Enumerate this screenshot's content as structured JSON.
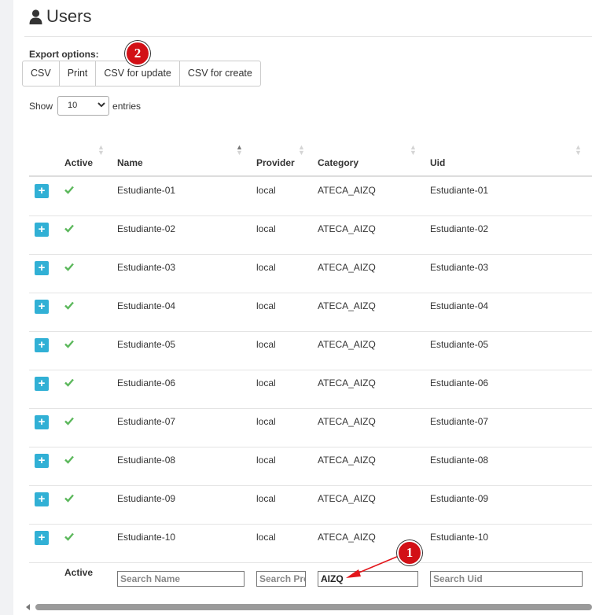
{
  "page": {
    "title": "Users",
    "icon": "user-icon"
  },
  "export": {
    "label": "Export options:",
    "buttons": [
      "CSV",
      "Print",
      "CSV for update",
      "CSV for create"
    ]
  },
  "length": {
    "show": "Show",
    "value": "10",
    "entries": "entries"
  },
  "table": {
    "columns": [
      "Active",
      "Name",
      "Provider",
      "Category",
      "Uid"
    ],
    "rows": [
      {
        "name": "Estudiante-01",
        "provider": "local",
        "category": "ATECA_AIZQ",
        "uid": "Estudiante-01"
      },
      {
        "name": "Estudiante-02",
        "provider": "local",
        "category": "ATECA_AIZQ",
        "uid": "Estudiante-02"
      },
      {
        "name": "Estudiante-03",
        "provider": "local",
        "category": "ATECA_AIZQ",
        "uid": "Estudiante-03"
      },
      {
        "name": "Estudiante-04",
        "provider": "local",
        "category": "ATECA_AIZQ",
        "uid": "Estudiante-04"
      },
      {
        "name": "Estudiante-05",
        "provider": "local",
        "category": "ATECA_AIZQ",
        "uid": "Estudiante-05"
      },
      {
        "name": "Estudiante-06",
        "provider": "local",
        "category": "ATECA_AIZQ",
        "uid": "Estudiante-06"
      },
      {
        "name": "Estudiante-07",
        "provider": "local",
        "category": "ATECA_AIZQ",
        "uid": "Estudiante-07"
      },
      {
        "name": "Estudiante-08",
        "provider": "local",
        "category": "ATECA_AIZQ",
        "uid": "Estudiante-08"
      },
      {
        "name": "Estudiante-09",
        "provider": "local",
        "category": "ATECA_AIZQ",
        "uid": "Estudiante-09"
      },
      {
        "name": "Estudiante-10",
        "provider": "local",
        "category": "ATECA_AIZQ",
        "uid": "Estudiante-10"
      }
    ],
    "expand_label": "+"
  },
  "footer": {
    "active_label": "Active",
    "search_name": "Search Name",
    "search_provider": "Search Provider",
    "search_category_value": "AIZQ",
    "search_uid": "Search Uid"
  },
  "annotations": {
    "badge1": "1",
    "badge2": "2"
  },
  "colors": {
    "accent": "#31b0d5",
    "check": "#5cb85c",
    "badge": "#d21016",
    "arrow": "#e3161b"
  }
}
